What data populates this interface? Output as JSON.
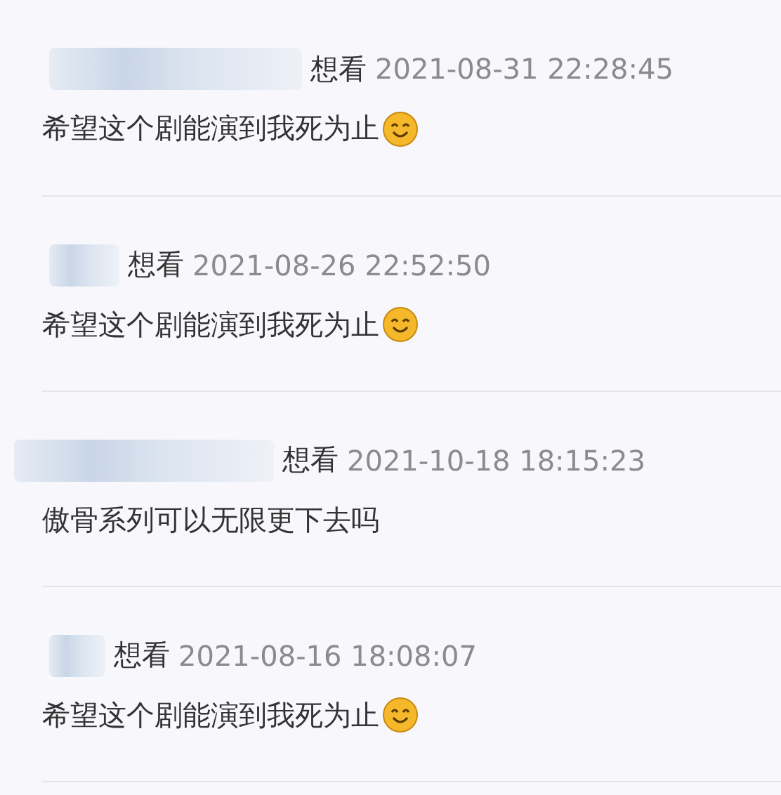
{
  "comments": [
    {
      "status": "想看",
      "time": "2021-08-31 22:28:45",
      "text": "希望这个剧能演到我死为止",
      "emoji": true
    },
    {
      "status": "想看",
      "time": "2021-08-26 22:52:50",
      "text": "希望这个剧能演到我死为止",
      "emoji": true
    },
    {
      "status": "想看",
      "time": "2021-10-18 18:15:23",
      "text": "傲骨系列可以无限更下去吗",
      "emoji": false
    },
    {
      "status": "想看",
      "time": "2021-08-16 18:08:07",
      "text": "希望这个剧能演到我死为止",
      "emoji": true
    }
  ]
}
